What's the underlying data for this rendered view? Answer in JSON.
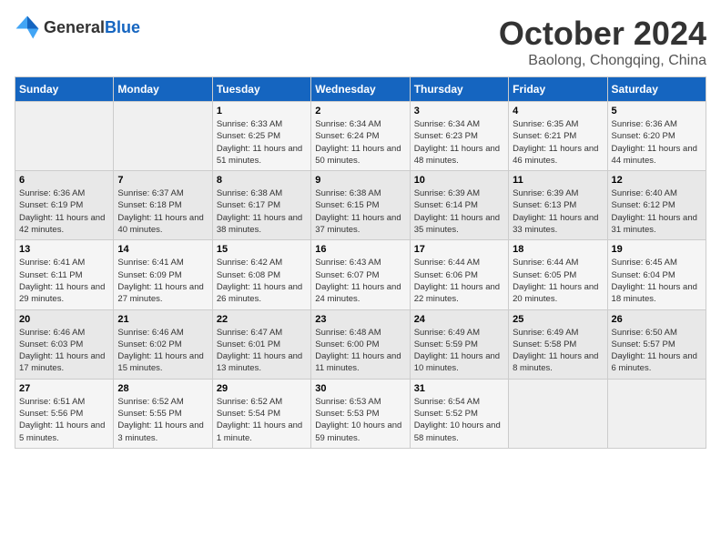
{
  "header": {
    "logo_general": "General",
    "logo_blue": "Blue",
    "month_title": "October 2024",
    "location": "Baolong, Chongqing, China"
  },
  "days_of_week": [
    "Sunday",
    "Monday",
    "Tuesday",
    "Wednesday",
    "Thursday",
    "Friday",
    "Saturday"
  ],
  "weeks": [
    [
      {
        "day": "",
        "sunrise": "",
        "sunset": "",
        "daylight": ""
      },
      {
        "day": "",
        "sunrise": "",
        "sunset": "",
        "daylight": ""
      },
      {
        "day": "1",
        "sunrise": "Sunrise: 6:33 AM",
        "sunset": "Sunset: 6:25 PM",
        "daylight": "Daylight: 11 hours and 51 minutes."
      },
      {
        "day": "2",
        "sunrise": "Sunrise: 6:34 AM",
        "sunset": "Sunset: 6:24 PM",
        "daylight": "Daylight: 11 hours and 50 minutes."
      },
      {
        "day": "3",
        "sunrise": "Sunrise: 6:34 AM",
        "sunset": "Sunset: 6:23 PM",
        "daylight": "Daylight: 11 hours and 48 minutes."
      },
      {
        "day": "4",
        "sunrise": "Sunrise: 6:35 AM",
        "sunset": "Sunset: 6:21 PM",
        "daylight": "Daylight: 11 hours and 46 minutes."
      },
      {
        "day": "5",
        "sunrise": "Sunrise: 6:36 AM",
        "sunset": "Sunset: 6:20 PM",
        "daylight": "Daylight: 11 hours and 44 minutes."
      }
    ],
    [
      {
        "day": "6",
        "sunrise": "Sunrise: 6:36 AM",
        "sunset": "Sunset: 6:19 PM",
        "daylight": "Daylight: 11 hours and 42 minutes."
      },
      {
        "day": "7",
        "sunrise": "Sunrise: 6:37 AM",
        "sunset": "Sunset: 6:18 PM",
        "daylight": "Daylight: 11 hours and 40 minutes."
      },
      {
        "day": "8",
        "sunrise": "Sunrise: 6:38 AM",
        "sunset": "Sunset: 6:17 PM",
        "daylight": "Daylight: 11 hours and 38 minutes."
      },
      {
        "day": "9",
        "sunrise": "Sunrise: 6:38 AM",
        "sunset": "Sunset: 6:15 PM",
        "daylight": "Daylight: 11 hours and 37 minutes."
      },
      {
        "day": "10",
        "sunrise": "Sunrise: 6:39 AM",
        "sunset": "Sunset: 6:14 PM",
        "daylight": "Daylight: 11 hours and 35 minutes."
      },
      {
        "day": "11",
        "sunrise": "Sunrise: 6:39 AM",
        "sunset": "Sunset: 6:13 PM",
        "daylight": "Daylight: 11 hours and 33 minutes."
      },
      {
        "day": "12",
        "sunrise": "Sunrise: 6:40 AM",
        "sunset": "Sunset: 6:12 PM",
        "daylight": "Daylight: 11 hours and 31 minutes."
      }
    ],
    [
      {
        "day": "13",
        "sunrise": "Sunrise: 6:41 AM",
        "sunset": "Sunset: 6:11 PM",
        "daylight": "Daylight: 11 hours and 29 minutes."
      },
      {
        "day": "14",
        "sunrise": "Sunrise: 6:41 AM",
        "sunset": "Sunset: 6:09 PM",
        "daylight": "Daylight: 11 hours and 27 minutes."
      },
      {
        "day": "15",
        "sunrise": "Sunrise: 6:42 AM",
        "sunset": "Sunset: 6:08 PM",
        "daylight": "Daylight: 11 hours and 26 minutes."
      },
      {
        "day": "16",
        "sunrise": "Sunrise: 6:43 AM",
        "sunset": "Sunset: 6:07 PM",
        "daylight": "Daylight: 11 hours and 24 minutes."
      },
      {
        "day": "17",
        "sunrise": "Sunrise: 6:44 AM",
        "sunset": "Sunset: 6:06 PM",
        "daylight": "Daylight: 11 hours and 22 minutes."
      },
      {
        "day": "18",
        "sunrise": "Sunrise: 6:44 AM",
        "sunset": "Sunset: 6:05 PM",
        "daylight": "Daylight: 11 hours and 20 minutes."
      },
      {
        "day": "19",
        "sunrise": "Sunrise: 6:45 AM",
        "sunset": "Sunset: 6:04 PM",
        "daylight": "Daylight: 11 hours and 18 minutes."
      }
    ],
    [
      {
        "day": "20",
        "sunrise": "Sunrise: 6:46 AM",
        "sunset": "Sunset: 6:03 PM",
        "daylight": "Daylight: 11 hours and 17 minutes."
      },
      {
        "day": "21",
        "sunrise": "Sunrise: 6:46 AM",
        "sunset": "Sunset: 6:02 PM",
        "daylight": "Daylight: 11 hours and 15 minutes."
      },
      {
        "day": "22",
        "sunrise": "Sunrise: 6:47 AM",
        "sunset": "Sunset: 6:01 PM",
        "daylight": "Daylight: 11 hours and 13 minutes."
      },
      {
        "day": "23",
        "sunrise": "Sunrise: 6:48 AM",
        "sunset": "Sunset: 6:00 PM",
        "daylight": "Daylight: 11 hours and 11 minutes."
      },
      {
        "day": "24",
        "sunrise": "Sunrise: 6:49 AM",
        "sunset": "Sunset: 5:59 PM",
        "daylight": "Daylight: 11 hours and 10 minutes."
      },
      {
        "day": "25",
        "sunrise": "Sunrise: 6:49 AM",
        "sunset": "Sunset: 5:58 PM",
        "daylight": "Daylight: 11 hours and 8 minutes."
      },
      {
        "day": "26",
        "sunrise": "Sunrise: 6:50 AM",
        "sunset": "Sunset: 5:57 PM",
        "daylight": "Daylight: 11 hours and 6 minutes."
      }
    ],
    [
      {
        "day": "27",
        "sunrise": "Sunrise: 6:51 AM",
        "sunset": "Sunset: 5:56 PM",
        "daylight": "Daylight: 11 hours and 5 minutes."
      },
      {
        "day": "28",
        "sunrise": "Sunrise: 6:52 AM",
        "sunset": "Sunset: 5:55 PM",
        "daylight": "Daylight: 11 hours and 3 minutes."
      },
      {
        "day": "29",
        "sunrise": "Sunrise: 6:52 AM",
        "sunset": "Sunset: 5:54 PM",
        "daylight": "Daylight: 11 hours and 1 minute."
      },
      {
        "day": "30",
        "sunrise": "Sunrise: 6:53 AM",
        "sunset": "Sunset: 5:53 PM",
        "daylight": "Daylight: 10 hours and 59 minutes."
      },
      {
        "day": "31",
        "sunrise": "Sunrise: 6:54 AM",
        "sunset": "Sunset: 5:52 PM",
        "daylight": "Daylight: 10 hours and 58 minutes."
      },
      {
        "day": "",
        "sunrise": "",
        "sunset": "",
        "daylight": ""
      },
      {
        "day": "",
        "sunrise": "",
        "sunset": "",
        "daylight": ""
      }
    ]
  ]
}
